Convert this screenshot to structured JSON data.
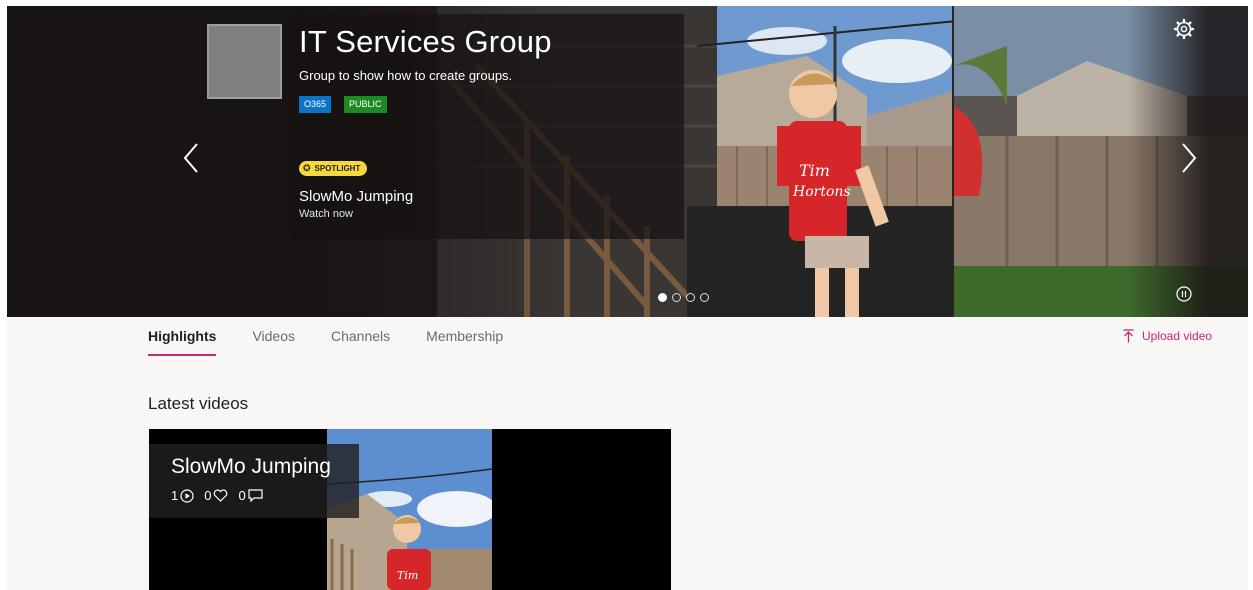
{
  "group": {
    "name": "IT Services Group",
    "description": "Group to show how to create groups.",
    "tags": [
      "O365",
      "PUBLIC"
    ]
  },
  "spotlight": {
    "badge": "SPOTLIGHT",
    "title": "SlowMo Jumping",
    "subtitle": "Watch now"
  },
  "carousel": {
    "slides": 4,
    "active_index": 0
  },
  "tabs": [
    {
      "label": "Highlights",
      "active": true
    },
    {
      "label": "Videos",
      "active": false
    },
    {
      "label": "Channels",
      "active": false
    },
    {
      "label": "Membership",
      "active": false
    }
  ],
  "actions": {
    "upload_label": "Upload video"
  },
  "latest": {
    "heading": "Latest videos",
    "videos": [
      {
        "title": "SlowMo Jumping",
        "views": "1",
        "likes": "0",
        "comments": "0"
      }
    ]
  },
  "colors": {
    "accent": "#c5286d",
    "tag_o365": "#0b73c9",
    "tag_public": "#1d8a23",
    "spotlight": "#f4d83d"
  },
  "icons": [
    "chevron-left-icon",
    "chevron-right-icon",
    "gear-icon",
    "pause-icon",
    "star-icon",
    "upload-icon",
    "play-icon",
    "heart-icon",
    "comment-icon"
  ]
}
